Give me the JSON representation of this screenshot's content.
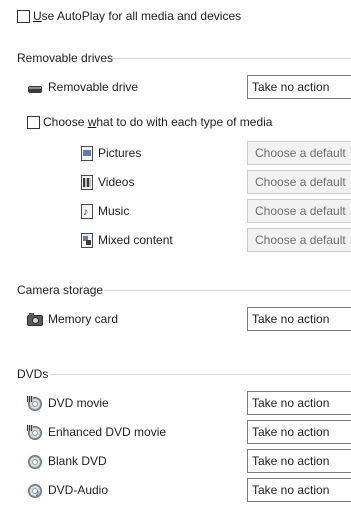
{
  "autoplay": {
    "label": "Use AutoPlay for all media and devices",
    "checked": false
  },
  "removable": {
    "title": "Removable drives",
    "drive": {
      "label": "Removable drive",
      "value": "Take no action",
      "icon": "removable-drive-icon"
    },
    "choose": {
      "label_prefix": "Choose ",
      "label_underline": "w",
      "label_suffix": "hat to do with each type of media",
      "checked": false
    },
    "media": [
      {
        "label": "Pictures",
        "value": "Choose a default",
        "icon": "pictures-icon"
      },
      {
        "label": "Videos",
        "value": "Choose a default",
        "icon": "videos-icon"
      },
      {
        "label": "Music",
        "value": "Choose a default",
        "icon": "music-icon"
      },
      {
        "label": "Mixed content",
        "value": "Choose a default",
        "icon": "mixed-content-icon"
      }
    ]
  },
  "camera": {
    "title": "Camera storage",
    "memory": {
      "label": "Memory card",
      "value": "Take no action",
      "icon": "camera-icon"
    }
  },
  "dvds": {
    "title": "DVDs",
    "items": [
      {
        "label": "DVD movie",
        "value": "Take no action",
        "icon": "dvd-movie-icon"
      },
      {
        "label": "Enhanced DVD movie",
        "value": "Take no action",
        "icon": "enhanced-dvd-icon"
      },
      {
        "label": "Blank DVD",
        "value": "Take no action",
        "icon": "blank-dvd-icon"
      },
      {
        "label": "DVD-Audio",
        "value": "Take no action",
        "icon": "dvd-audio-icon"
      }
    ]
  },
  "colors": {
    "rule": "#d9d9d9",
    "border": "#7a7a7a",
    "disabled_bg": "#f2f2f2"
  }
}
